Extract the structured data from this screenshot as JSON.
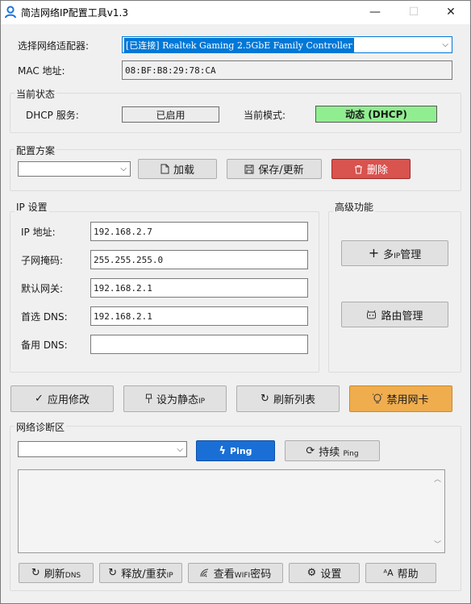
{
  "window": {
    "title": "简洁网络IP配置工具v1.3",
    "min_glyph": "—",
    "max_glyph": "☐",
    "close_glyph": "✕"
  },
  "adapter": {
    "label": "选择网络适配器:",
    "selected": "[已连接] Realtek Gaming 2.5GbE Family Controller",
    "mac_label": "MAC 地址:",
    "mac_value": "08:BF:B8:29:78:CA"
  },
  "status": {
    "group_title": "当前状态",
    "dhcp_label": "DHCP 服务:",
    "dhcp_value": "已启用",
    "mode_label": "当前模式:",
    "mode_value": "动态 (DHCP)",
    "mode_color": "#90ee90"
  },
  "profiles": {
    "group_title": "配置方案",
    "selected": "",
    "load_label": "加载",
    "save_label": "保存/更新",
    "delete_label": "删除",
    "delete_color": "#d9534f"
  },
  "ip_settings": {
    "group_title": "IP 设置",
    "fields": [
      {
        "label": "IP 地址:",
        "value": "192.168.2.7"
      },
      {
        "label": "子网掩码:",
        "value": "255.255.255.0"
      },
      {
        "label": "默认网关:",
        "value": "192.168.2.1"
      },
      {
        "label": "首选 DNS:",
        "value": "192.168.2.1"
      },
      {
        "label": "备用 DNS:",
        "value": ""
      }
    ]
  },
  "advanced": {
    "group_title": "高级功能",
    "multi_ip_prefix": "多",
    "multi_ip_small": "IP",
    "multi_ip_suffix": "管理",
    "route_label": "路由管理"
  },
  "actions": {
    "apply_label": "应用修改",
    "static_label": "设为静态",
    "static_small": "IP",
    "refresh_label": "刷新列表",
    "disable_label": "禁用网卡",
    "disable_color": "#f0ad4e"
  },
  "diagnostics": {
    "group_title": "网络诊断区",
    "target": "",
    "ping_label": "Ping",
    "ping_color": "#1a6fd6",
    "continuous_label": "持续",
    "continuous_small": "Ping",
    "log_text": ""
  },
  "bottom": {
    "refresh_dns_label": "刷新",
    "refresh_dns_small": "DNS",
    "release_label": "释放/重获",
    "release_small": "IP",
    "wifi_prefix": "查看",
    "wifi_small": "WIFI",
    "wifi_suffix": "密码",
    "settings_label": "设置",
    "help_label": "帮助"
  }
}
